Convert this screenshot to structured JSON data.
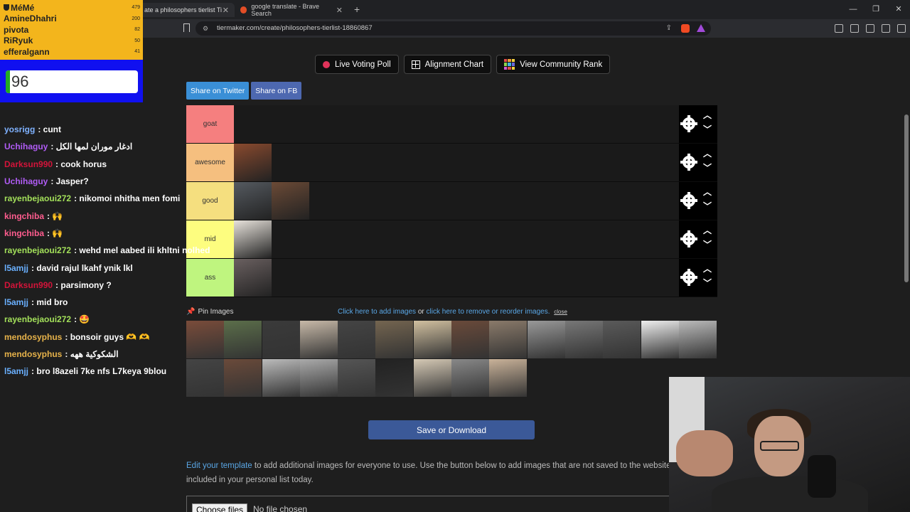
{
  "browser": {
    "tabs": [
      {
        "title": "ate a philosophers tierlist Ti",
        "active": true
      },
      {
        "title": "google translate - Brave Search",
        "active": false
      }
    ],
    "url": "tiermaker.com/create/philosophers-tierlist-18860867"
  },
  "leaderboard": {
    "title": "MéMé",
    "entries": [
      {
        "name": "MéMé",
        "score": "479"
      },
      {
        "name": "AmineDhahri",
        "score": "200"
      },
      {
        "name": "pivota",
        "score": "82"
      },
      {
        "name": "RiRyuk",
        "score": "50"
      },
      {
        "name": "efferalgann",
        "score": "41"
      }
    ]
  },
  "counter": {
    "value": "96"
  },
  "chat": {
    "messages": [
      {
        "user": "yosrigg",
        "text": ": cunt",
        "color": "#7fb2ff"
      },
      {
        "user": "Uchihaguy",
        "text": ": ادغار موران لمها الكل",
        "color": "#b05cf5"
      },
      {
        "user": "Darksun990",
        "text": ": cook horus",
        "color": "#d4143a"
      },
      {
        "user": "Uchihaguy",
        "text": ": Jasper?",
        "color": "#b05cf5"
      },
      {
        "user": "rayenbejaoui272",
        "text": ": nikomoi nhitha men fomi",
        "color": "#a3e05a"
      },
      {
        "user": "kingchiba",
        "text": ": 🙌",
        "color": "#ff5d8f"
      },
      {
        "user": "kingchiba",
        "text": ": 🙌",
        "color": "#ff5d8f"
      },
      {
        "user": "rayenbejaoui272",
        "text": ": wehd mel aabed ili khltni nolhed",
        "color": "#a3e05a"
      },
      {
        "user": "l5amjj",
        "text": ": david rajul lkahf ynik lkl",
        "color": "#6ab0ff"
      },
      {
        "user": "Darksun990",
        "text": ": parsimony ?",
        "color": "#d4143a"
      },
      {
        "user": "l5amjj",
        "text": ": mid bro",
        "color": "#6ab0ff"
      },
      {
        "user": "rayenbejaoui272",
        "text": ": 🤩",
        "color": "#a3e05a"
      },
      {
        "user": "mendosyphus",
        "text": ": bonsoir guys 🫶 🫶",
        "color": "#e6b24a"
      },
      {
        "user": "mendosyphus",
        "text": ": الشكوكية ههه",
        "color": "#e6b24a"
      },
      {
        "user": "l5amjj",
        "text": ": bro l8azeli 7ke nfs L7keya 9blou",
        "color": "#6ab0ff"
      }
    ]
  },
  "toolbar_buttons": {
    "live_voting": "Live Voting Poll",
    "alignment": "Alignment Chart",
    "community": "View Community Rank"
  },
  "share": {
    "twitter": "Share on Twitter",
    "fb": "Share on FB"
  },
  "tiers": [
    {
      "label": "goat",
      "color": "#f57f7f",
      "items": []
    },
    {
      "label": "awesome",
      "color": "#f5bf7f",
      "items": [
        "#8a4a2e"
      ]
    },
    {
      "label": "good",
      "color": "#f5df7f",
      "items": [
        "#555a60",
        "#6b4a36"
      ]
    },
    {
      "label": "mid",
      "color": "#fdfd7f",
      "items": [
        "#e8e3dc"
      ]
    },
    {
      "label": "ass",
      "color": "#bff57f",
      "items": [
        "#6a6060"
      ]
    }
  ],
  "pin": {
    "title": "Pin Images",
    "add_link": "Click here to add images",
    "or": "or",
    "remove_link": "click here to remove or reorder images.",
    "close": "close"
  },
  "pool_images": [
    "#7a4c3a",
    "#5b6e4a",
    "#3a3a3a",
    "#c7b9a8",
    "#444",
    "#746550",
    "#d1c0a0",
    "#6a4a3a",
    "#8a7a6a",
    "#999",
    "#777",
    "#5a5a5a",
    "#eee",
    "#bbb",
    "#444",
    "#6a4a3a",
    "#bbb",
    "#aaa",
    "#555",
    "#222",
    "#d5c9b5",
    "#888",
    "#c9b299"
  ],
  "save_button": "Save or Download",
  "info": {
    "link": "Edit your template",
    "text": " to add additional images for everyone to use. Use the button below to add images that are not saved to the website, t",
    "text2": "included in your personal list today."
  },
  "file": {
    "button": "Choose files",
    "status": "No file chosen"
  }
}
